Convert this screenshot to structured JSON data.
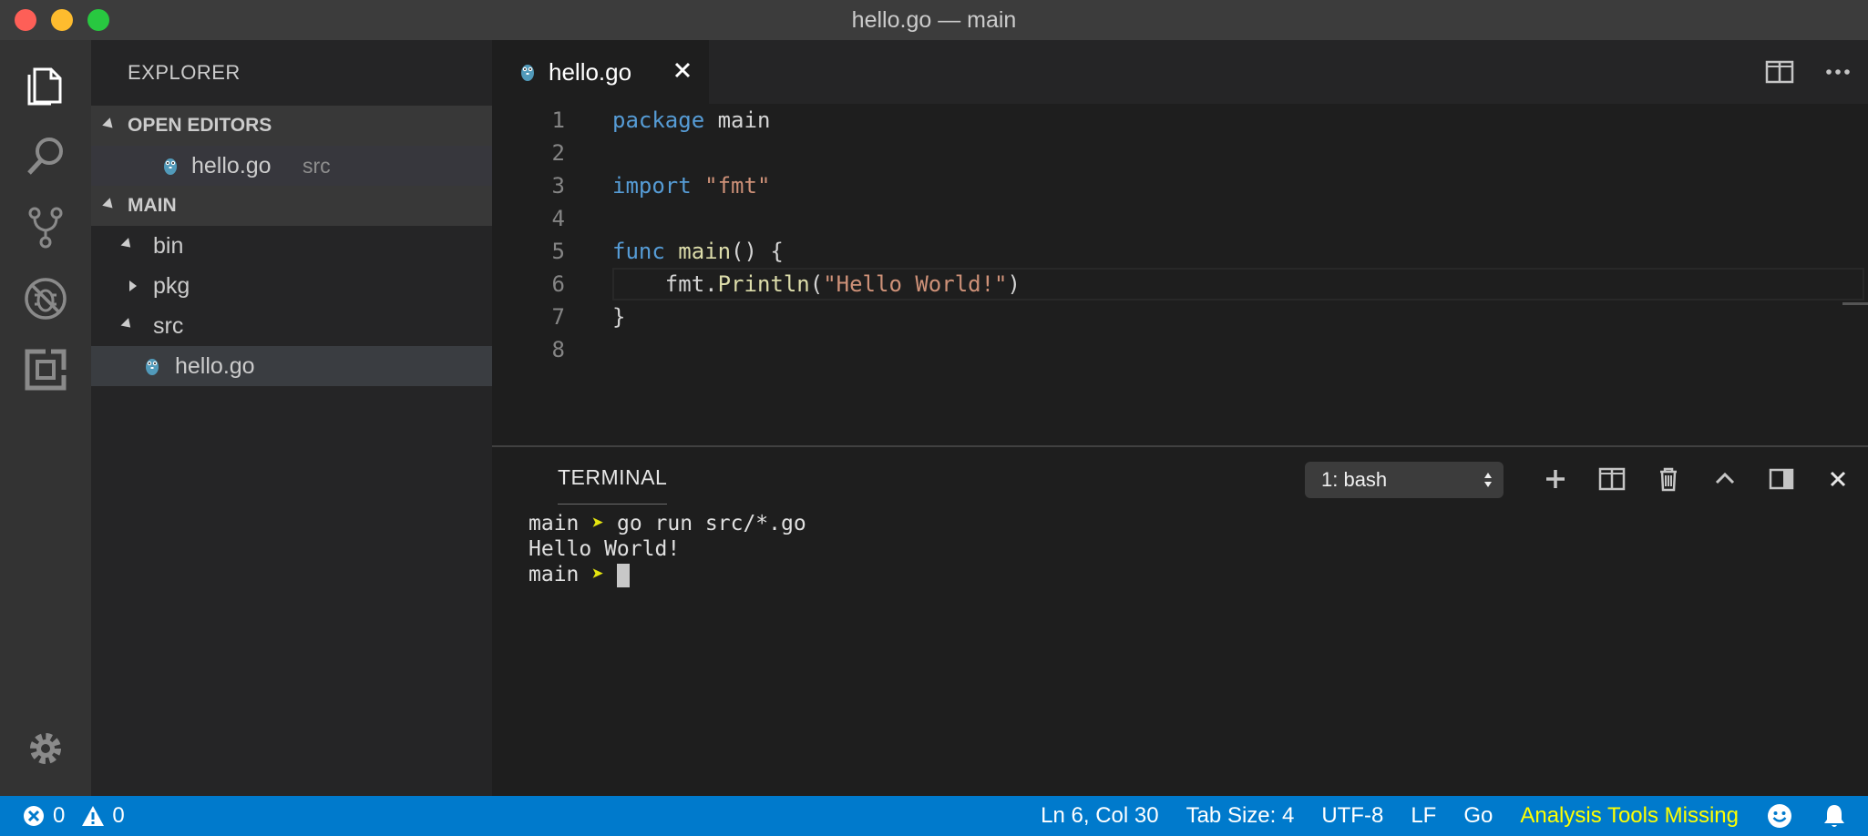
{
  "window": {
    "title": "hello.go — main"
  },
  "activity_bar": {
    "items": [
      {
        "icon": "files-icon"
      },
      {
        "icon": "search-icon"
      },
      {
        "icon": "source-control-icon"
      },
      {
        "icon": "debug-icon"
      },
      {
        "icon": "extensions-icon"
      },
      {
        "icon": "gear-icon"
      }
    ]
  },
  "sidebar": {
    "header": "EXPLORER",
    "open_editors": {
      "title": "OPEN EDITORS",
      "items": [
        {
          "name": "hello.go",
          "folder": "src"
        }
      ]
    },
    "project": {
      "title": "MAIN",
      "tree": [
        {
          "name": "bin",
          "type": "folder",
          "expanded": true
        },
        {
          "name": "pkg",
          "type": "folder",
          "expanded": false
        },
        {
          "name": "src",
          "type": "folder",
          "expanded": true
        },
        {
          "name": "hello.go",
          "type": "file"
        }
      ]
    }
  },
  "editor": {
    "tab": {
      "label": "hello.go",
      "close": "×"
    },
    "lines": [
      {
        "num": "1"
      },
      {
        "num": "2"
      },
      {
        "num": "3"
      },
      {
        "num": "4"
      },
      {
        "num": "5"
      },
      {
        "num": "6"
      },
      {
        "num": "7"
      },
      {
        "num": "8"
      }
    ],
    "code": {
      "l1_kw": "package",
      "l1_rest": " main",
      "l3_kw": "import",
      "l3_str": "\"fmt\"",
      "l5_kw": "func",
      "l5_fn": "main",
      "l5_rest": "() {",
      "l6_pkg": "fmt.",
      "l6_fn": "Println",
      "l6_open": "(",
      "l6_str": "\"Hello World!\"",
      "l6_close": ")",
      "l7": "}"
    }
  },
  "panel": {
    "tab": "TERMINAL",
    "terminal_select": "1: bash",
    "terminal_lines": {
      "prompt1": "main",
      "arrow": "➤",
      "cmd1": " go run src/*.go",
      "output": "Hello World!",
      "prompt2": "main"
    }
  },
  "statusbar": {
    "errors": "0",
    "warnings": "0",
    "position": "Ln 6, Col 30",
    "tab_size": "Tab Size: 4",
    "encoding": "UTF-8",
    "eol": "LF",
    "language": "Go",
    "warning_msg": "Analysis Tools Missing"
  },
  "colors": {
    "statusbar": "#007acc",
    "activity_bar": "#333333",
    "sidebar": "#252526",
    "editor": "#1e1e1e",
    "keyword": "#569cd6",
    "string": "#ce9178",
    "function": "#dcdcaa",
    "warning": "#ffff00"
  }
}
